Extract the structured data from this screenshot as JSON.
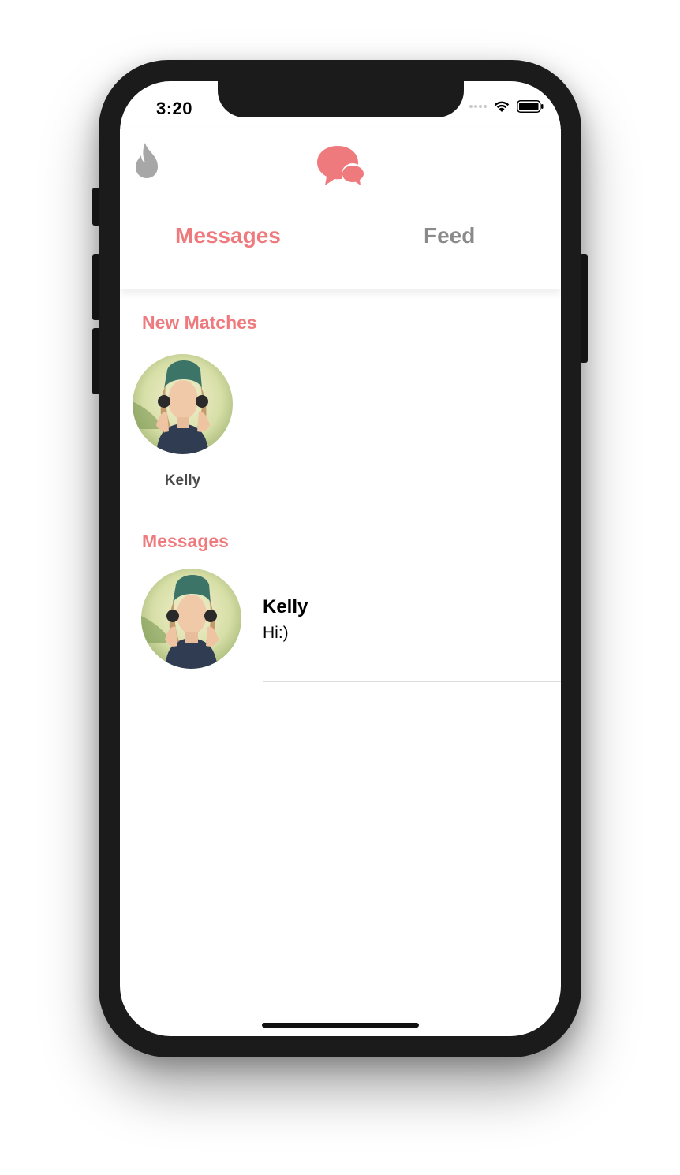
{
  "status_bar": {
    "time": "3:20"
  },
  "header": {
    "left_icon": "flame-icon",
    "center_icon": "chat-bubbles-icon",
    "tabs": [
      {
        "label": "Messages",
        "active": true
      },
      {
        "label": "Feed",
        "active": false
      }
    ]
  },
  "new_matches": {
    "title": "New Matches",
    "items": [
      {
        "name": "Kelly"
      }
    ]
  },
  "messages": {
    "title": "Messages",
    "items": [
      {
        "name": "Kelly",
        "preview": "Hi:)"
      }
    ]
  },
  "colors": {
    "accent": "#ef7a7d",
    "inactive_tab": "#8a8a8a",
    "flame": "#a7a7a7"
  }
}
